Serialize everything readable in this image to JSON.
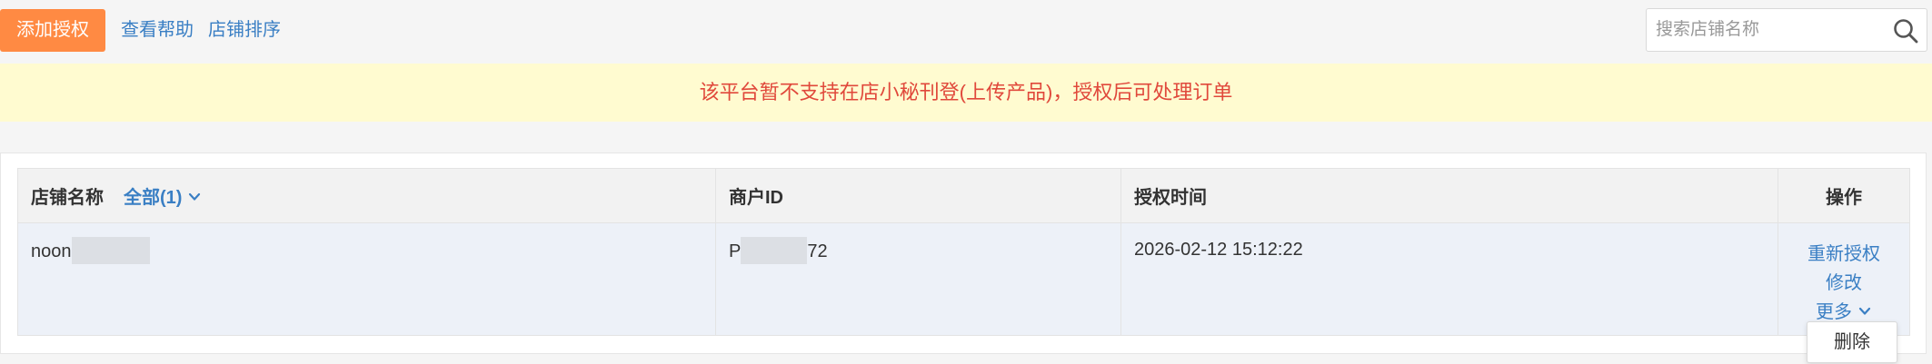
{
  "toolbar": {
    "add_label": "添加授权",
    "help_label": "查看帮助",
    "sort_label": "店铺排序"
  },
  "search": {
    "placeholder": "搜索店铺名称",
    "value": ""
  },
  "notice": {
    "text": "该平台暂不支持在店小秘刊登(上传产品)，授权后可处理订单"
  },
  "table": {
    "headers": {
      "shop_name": "店铺名称",
      "filter": "全部(1)",
      "merchant_id": "商户ID",
      "auth_time": "授权时间",
      "actions": "操作"
    },
    "rows": [
      {
        "shop_name_prefix": "noon",
        "merchant_id_prefix": "P",
        "merchant_id_suffix": "72",
        "auth_time": "2026-02-12 15:12:22",
        "actions": {
          "reauth": "重新授权",
          "edit": "修改",
          "more": "更多"
        }
      }
    ]
  },
  "dropdown": {
    "delete_label": "删除"
  },
  "colors": {
    "primary_button": "#ff8a43",
    "link": "#3a7fc4",
    "notice_bg": "#fffbd0",
    "notice_text": "#e0483b",
    "row_bg": "#edf1f8"
  }
}
